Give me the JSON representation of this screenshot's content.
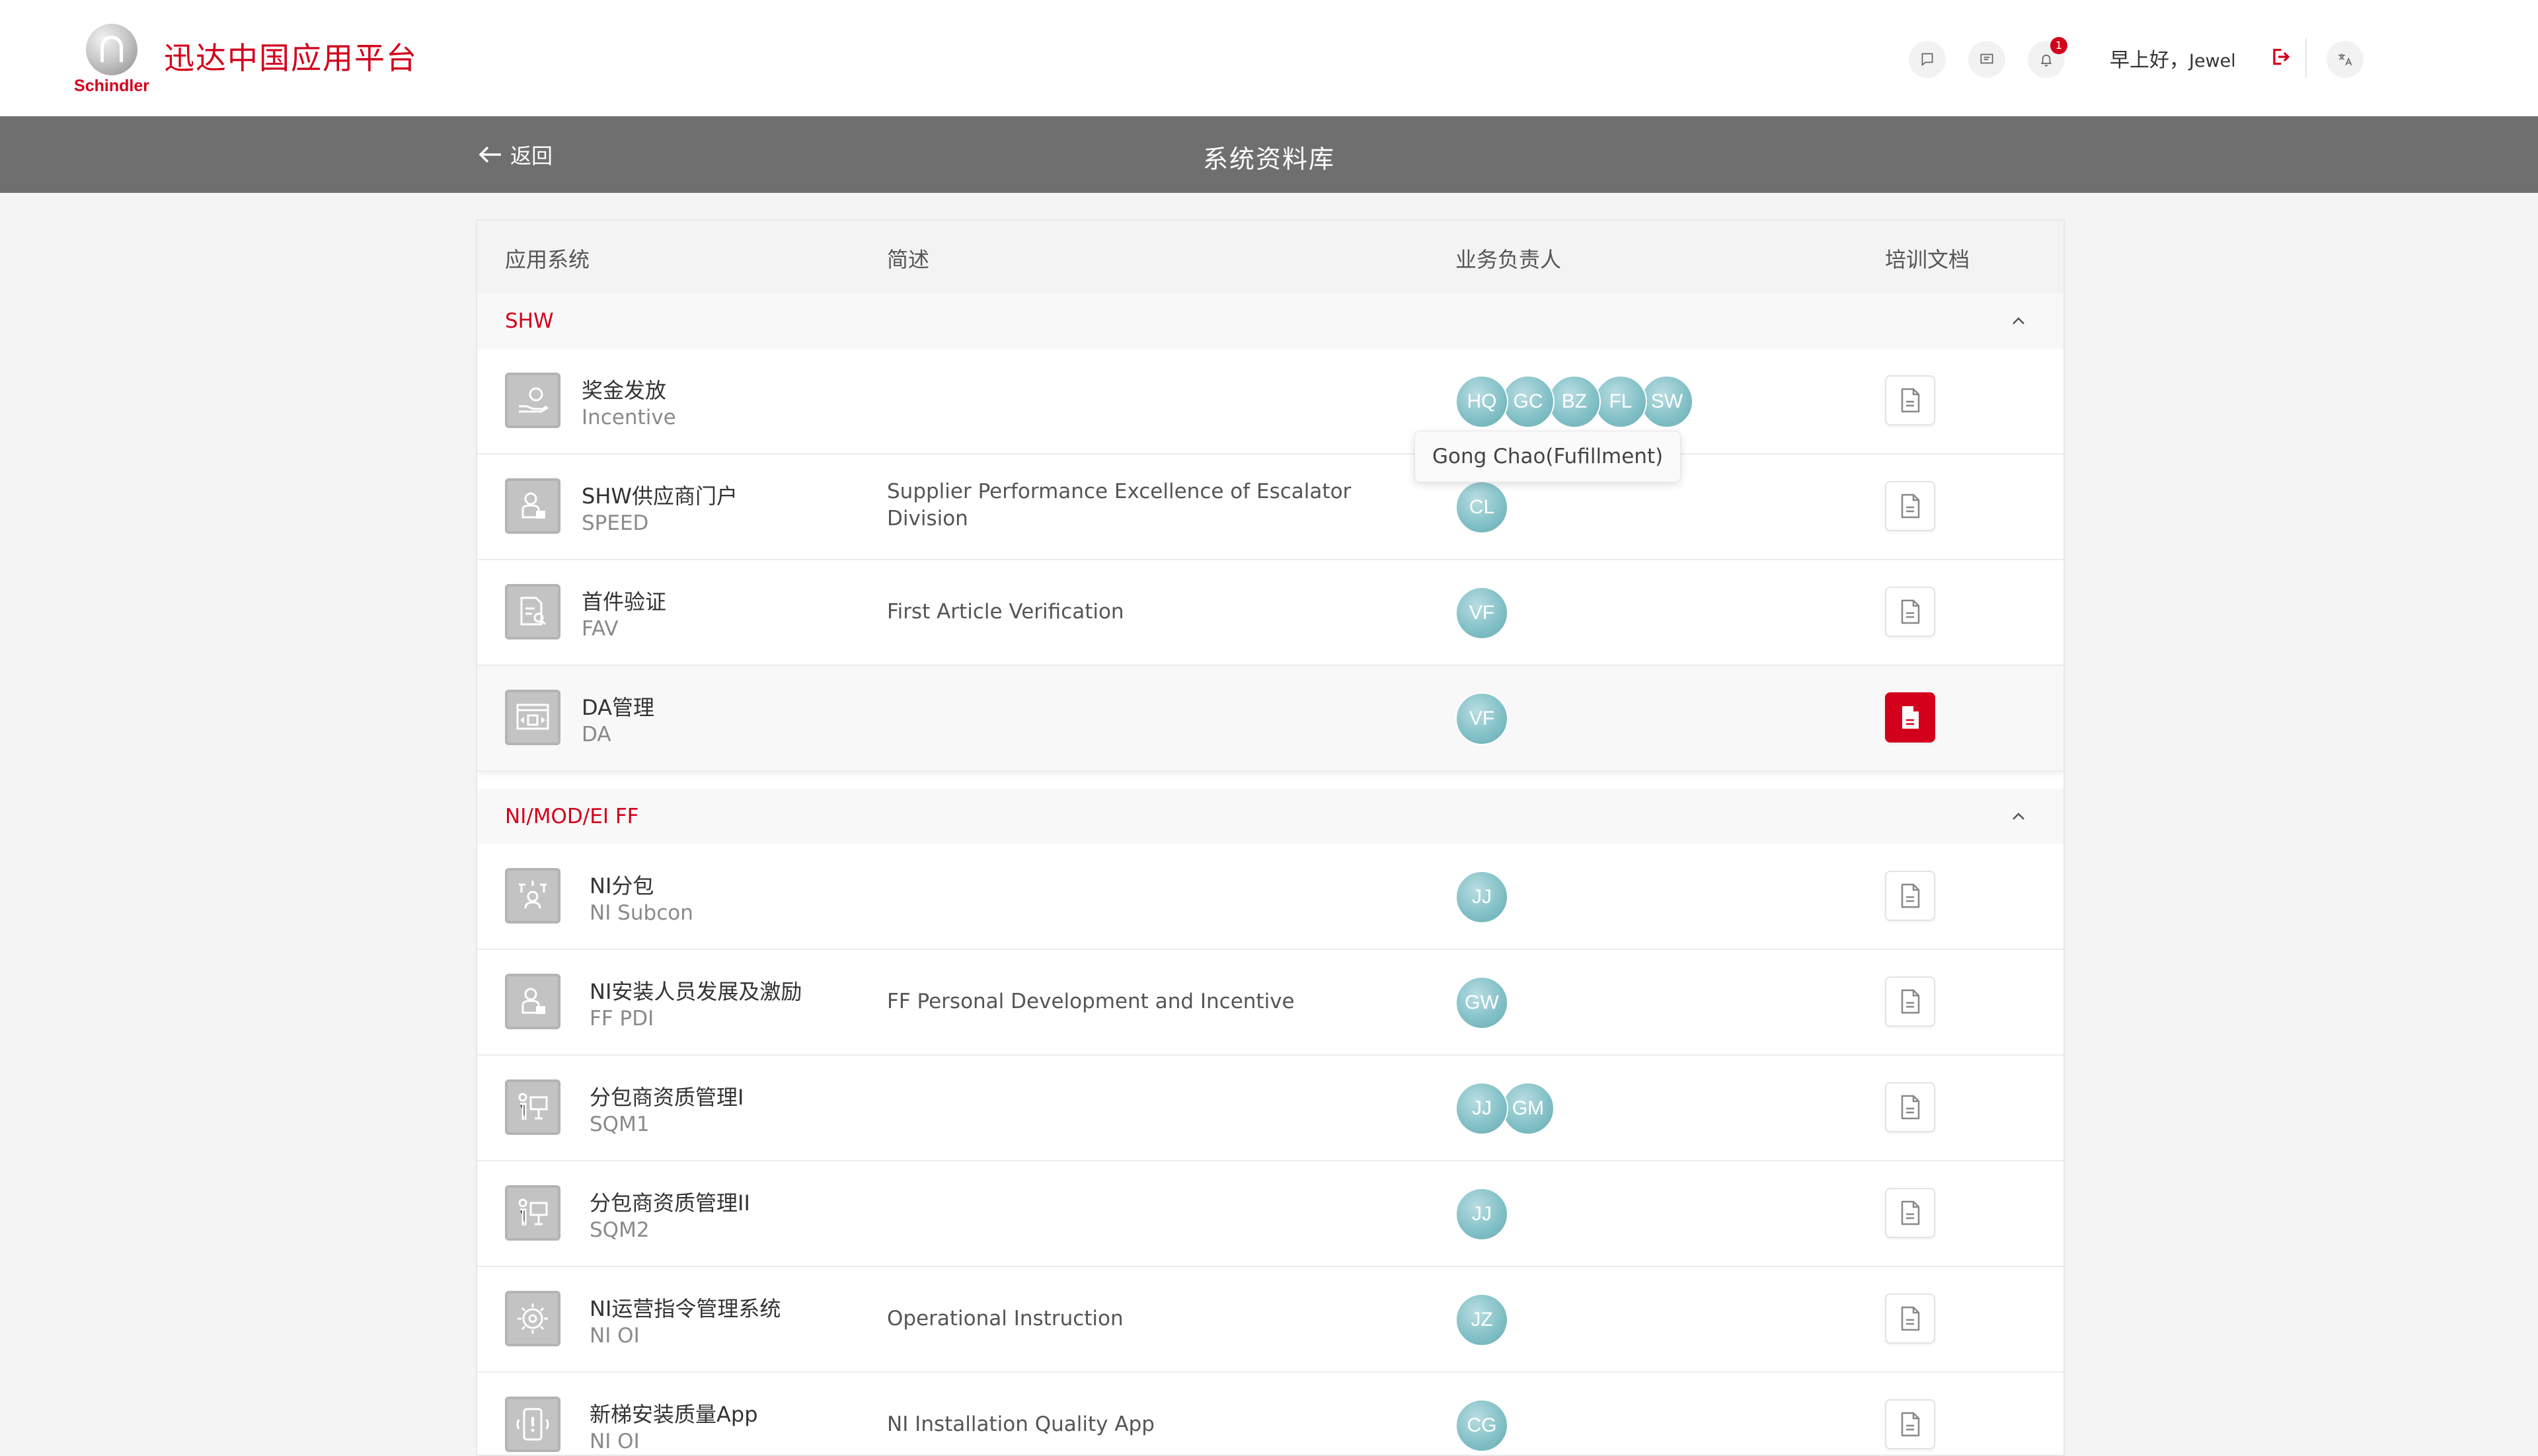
{
  "header": {
    "logo_text": "Schindler",
    "app_title": "迅达中国应用平台",
    "notification_count": "1",
    "greeting": "早上好，",
    "user_name": "Jewel"
  },
  "subheader": {
    "back_label": "返回",
    "title": "系统资料库"
  },
  "table": {
    "columns": [
      "应用系统",
      "简述",
      "业务负责人",
      "培训文档"
    ],
    "groups": [
      {
        "name": "SHW",
        "rows": [
          {
            "name": "奖金发放",
            "code": "Incentive",
            "desc": "",
            "owners": [
              "HQ",
              "GC",
              "BZ",
              "FL",
              "SW"
            ],
            "icon": "hand-coin-icon"
          },
          {
            "name": "SHW供应商门户",
            "code": "SPEED",
            "desc": "Supplier Performance Excellence of Escalator Division",
            "owners": [
              "CL"
            ],
            "icon": "user-portal-icon"
          },
          {
            "name": "首件验证",
            "code": "FAV",
            "desc": "First Article Verification",
            "owners": [
              "VF"
            ],
            "icon": "document-search-icon"
          },
          {
            "name": "DA管理",
            "code": "DA",
            "desc": "",
            "owners": [
              "VF"
            ],
            "icon": "window-arrows-icon",
            "doc_active": true
          }
        ]
      },
      {
        "name": "NI/MOD/EI FF",
        "rows": [
          {
            "name": "NI分包",
            "code": "NI Subcon",
            "desc": "",
            "owners": [
              "JJ"
            ],
            "icon": "subcon-network-icon"
          },
          {
            "name": "NI安装人员发展及激励",
            "code": "FF PDI",
            "desc": "FF Personal Development and Incentive",
            "owners": [
              "GW"
            ],
            "icon": "user-portal-icon"
          },
          {
            "name": "分包商资质管理I",
            "code": "SQM1",
            "desc": "",
            "owners": [
              "JJ",
              "GM"
            ],
            "icon": "presenter-board-icon"
          },
          {
            "name": "分包商资质管理II",
            "code": "SQM2",
            "desc": "",
            "owners": [
              "JJ"
            ],
            "icon": "presenter-board-icon"
          },
          {
            "name": "NI运营指令管理系统",
            "code": "NI OI",
            "desc": "Operational Instruction",
            "owners": [
              "JZ"
            ],
            "icon": "gear-people-icon"
          },
          {
            "name": "新梯安装质量App",
            "code": "NI OI",
            "desc": "NI Installation Quality App",
            "owners": [
              "CG"
            ],
            "icon": "phone-alert-icon"
          }
        ]
      }
    ]
  },
  "tooltip": {
    "text": "Gong Chao(Fufillment)"
  },
  "colors": {
    "brand_red": "#d3001c",
    "subheader_grey": "#6f6f6f",
    "avatar_teal": "#7fbfc5"
  }
}
